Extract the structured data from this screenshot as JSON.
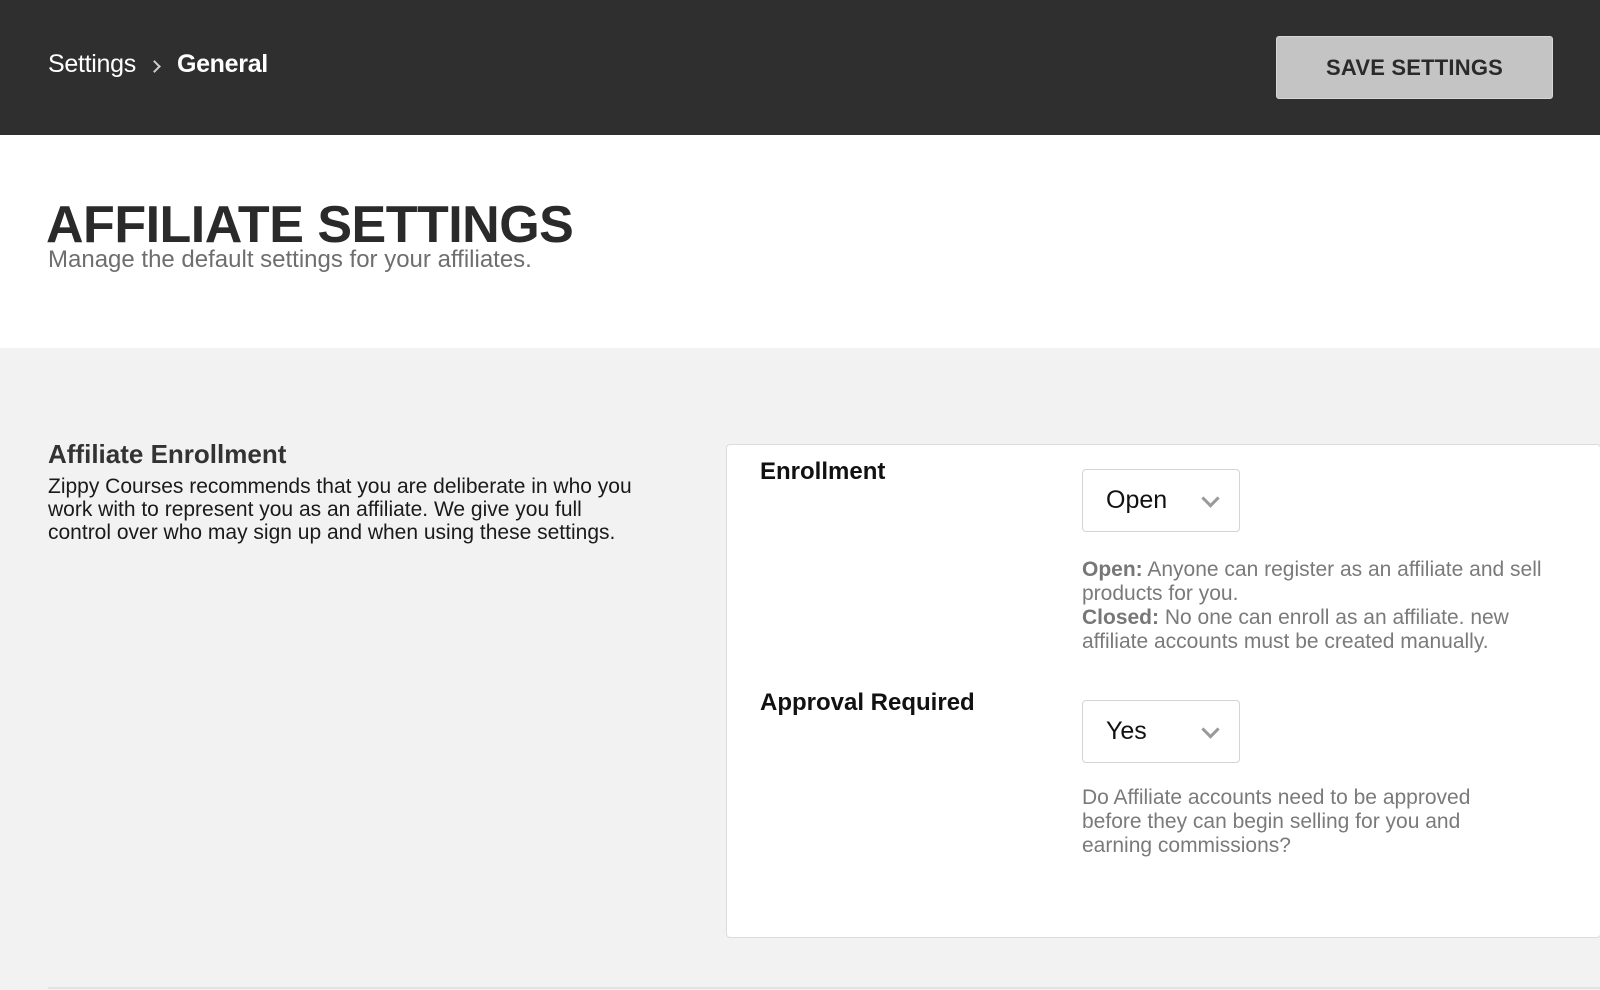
{
  "breadcrumb": {
    "root": "Settings",
    "current": "General"
  },
  "toolbar": {
    "save_label": "SAVE SETTINGS"
  },
  "page": {
    "title": "AFFILIATE SETTINGS",
    "subtitle": "Manage the default settings for your affiliates."
  },
  "section": {
    "title": "Affiliate Enrollment",
    "description": "Zippy Courses recommends that you are deliberate in who you work with to represent you as an affiliate. We give you full control over who may sign up and when using these settings."
  },
  "fields": {
    "enrollment": {
      "label": "Enrollment",
      "value": "Open",
      "help_open_term": "Open:",
      "help_open_text": " Anyone can register as an affiliate and sell products for you.",
      "help_closed_term": "Closed:",
      "help_closed_text": " No one can enroll as an affiliate. new affiliate accounts must be created manually."
    },
    "approval": {
      "label": "Approval Required",
      "value": "Yes",
      "help": "Do Affiliate accounts need to be approved before they can begin selling for you and earning commissions?"
    }
  },
  "icons": {
    "breadcrumb_separator": "chevron-right-icon",
    "select_arrow": "chevron-down-icon"
  },
  "colors": {
    "topbar": "#2f2f2f",
    "save_button": "#c4c4c4",
    "page_background": "#f2f2f2"
  }
}
